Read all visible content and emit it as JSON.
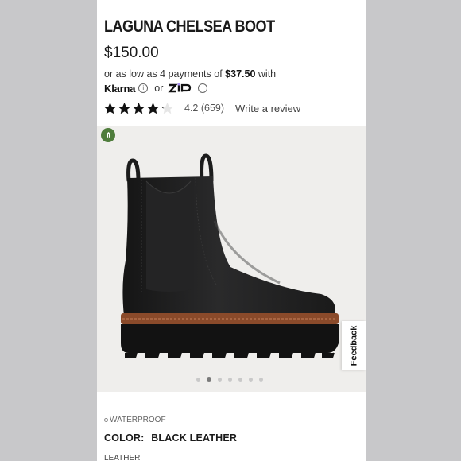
{
  "product": {
    "title": "LAGUNA CHELSEA BOOT",
    "price": "$150.00"
  },
  "installments": {
    "prefix": "or as low as 4 payments of",
    "amount": "$37.50",
    "suffix": "with",
    "provider_1": "Klarna",
    "or_text": "or",
    "provider_2_icon": "zip-logo-icon"
  },
  "rating": {
    "value": 4.2,
    "max": 5,
    "text": "4.2 (659)",
    "write_review": "Write a review"
  },
  "gallery": {
    "badge_icon": "eco-leaf-icon",
    "slide_count": 7,
    "active_slide": 2,
    "feedback_label": "Feedback"
  },
  "details": {
    "feature": "WATERPROOF",
    "color_label": "COLOR:",
    "color_value": "BLACK LEATHER",
    "material": "LEATHER"
  },
  "colors": {
    "background": "#c7c7c9",
    "page": "#ffffff",
    "eco_badge": "#4f7d3c",
    "boot": "#1b1b1c",
    "sole_welt": "#8a4a2a"
  }
}
